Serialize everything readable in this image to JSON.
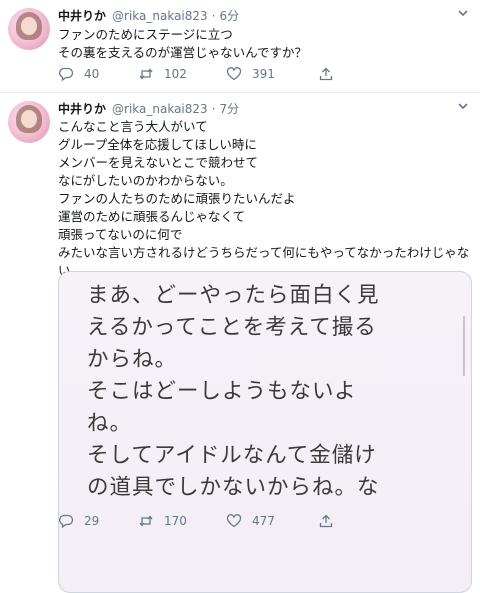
{
  "tweets": [
    {
      "display_name": "中井りか",
      "handle": "@rika_nakai823",
      "separator": "·",
      "time": "6分",
      "text_lines": [
        "ファンのためにステージに立つ",
        "その裏を支えるのが運営じゃないんですか？"
      ],
      "replies": "40",
      "retweets": "102",
      "likes": "391"
    },
    {
      "display_name": "中井りか",
      "handle": "@rika_nakai823",
      "separator": "·",
      "time": "7分",
      "text_lines": [
        "こんなこと言う大人がいて",
        "グループ全体を応援してほしい時に",
        "メンバーを見えないとこで競わせて",
        "なにがしたいのかわからない。",
        "ファンの人たちのために頑張りたいんだよ",
        "運営のために頑張るんじゃなくて",
        "頑張ってないのに何で",
        "みたいな言い方されるけどうちらだって何にもやってなかったわけじゃない"
      ],
      "image_text_lines": [
        "まあ、どーやったら面白く見",
        "えるかってことを考えて撮る",
        "からね。",
        "そこはどーしようもないよ",
        "ね。",
        "そしてアイドルなんて金儲け",
        "の道具でしかないからね。な"
      ],
      "replies": "29",
      "retweets": "170",
      "likes": "477"
    }
  ],
  "icons": {
    "reply": "speech-bubble-icon",
    "retweet": "retweet-arrows-icon",
    "like": "heart-icon",
    "share": "share-upload-icon",
    "more": "chevron-down-icon"
  },
  "colors": {
    "text": "#14171a",
    "secondary": "#657786",
    "border": "#e6ecf0"
  }
}
